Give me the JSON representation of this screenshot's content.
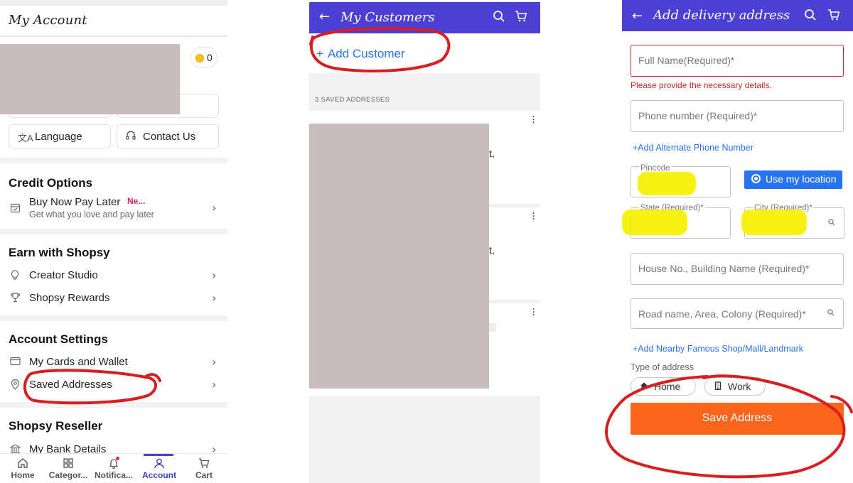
{
  "colors": {
    "brand_purple": "#4b3fd6",
    "link_blue": "#2874f0",
    "save_orange": "#fb641b",
    "error_red": "#c62828",
    "redaction": "#c8bcbc",
    "highlighter": "#f7f000",
    "annotation_red": "#d81e1e"
  },
  "account": {
    "title": "My Account",
    "coins": "0",
    "buttons": [
      {
        "label": "Language",
        "icon": "translate-icon"
      },
      {
        "label": "Contact Us",
        "icon": "headset-icon"
      }
    ],
    "credit": {
      "title": "Credit Options",
      "item_label": "Buy Now Pay Later",
      "item_badge": "Ne...",
      "item_sub": "Get what you love and pay later"
    },
    "earn": {
      "title": "Earn with Shopsy",
      "items": [
        "Creator Studio",
        "Shopsy Rewards"
      ]
    },
    "settings": {
      "title": "Account Settings",
      "items": [
        "My Cards and Wallet",
        "Saved Addresses"
      ]
    },
    "reseller": {
      "title": "Shopsy Reseller",
      "items": [
        "My Bank Details"
      ]
    },
    "nav": [
      "Home",
      "Categor...",
      "Notifica...",
      "Account",
      "Cart"
    ],
    "nav_active": "Account"
  },
  "customers": {
    "title": "My Customers",
    "add_label": "Add Customer",
    "count_label": "3 SAVED ADDRESSES",
    "card_fragments": [
      "t,",
      "t,"
    ]
  },
  "delivery": {
    "title": "Add delivery address",
    "full_name_placeholder": "Full Name(Required)*",
    "error_text": "Please provide the necessary details.",
    "phone_placeholder": "Phone number (Required)*",
    "alt_phone_link": "+Add Alternate Phone Number",
    "pincode_label": "Pincode",
    "use_location_label": "Use my location",
    "state_label": "State (Required)*",
    "city_label": "City (Required)*",
    "house_placeholder": "House No., Building Name (Required)*",
    "road_placeholder": "Road name, Area, Colony (Required)*",
    "landmark_link": "+Add Nearby Famous Shop/Mall/Landmark",
    "type_label": "Type of address",
    "types": [
      "Home",
      "Work"
    ],
    "save_label": "Save Address"
  }
}
